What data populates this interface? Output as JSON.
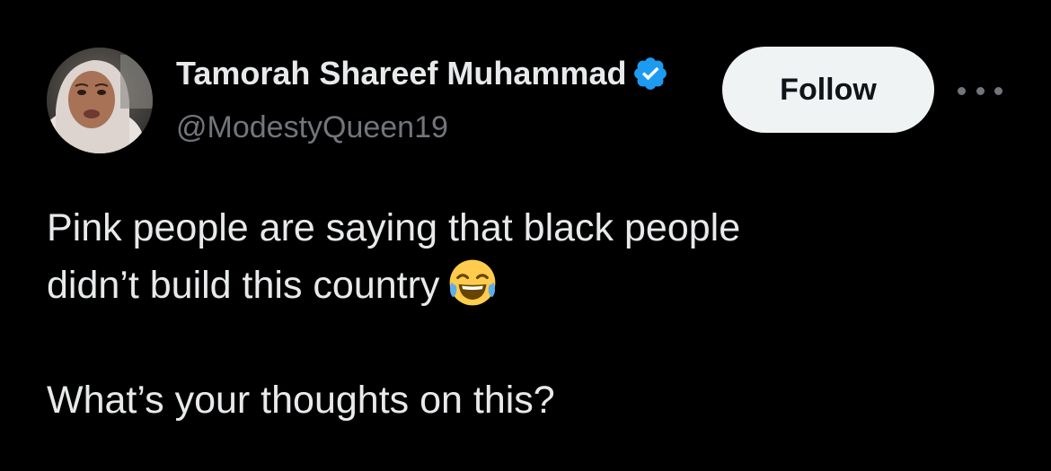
{
  "author": {
    "display_name": "Tamorah Shareef Muhammad",
    "handle": "@ModestyQueen19",
    "verified": true,
    "verified_color": "#1d9bf0"
  },
  "actions": {
    "follow_label": "Follow",
    "more_icon": "more-horizontal-icon"
  },
  "tweet": {
    "line1": "Pink people are saying that black people",
    "line2": "didn’t build this country",
    "emoji": "face-with-tears-of-joy",
    "line3": "What’s your thoughts on this?"
  },
  "colors": {
    "background": "#000000",
    "text": "#e7e9ea",
    "secondary_text": "#71767b",
    "follow_button_bg": "#eff3f4",
    "follow_button_text": "#0f1419"
  }
}
